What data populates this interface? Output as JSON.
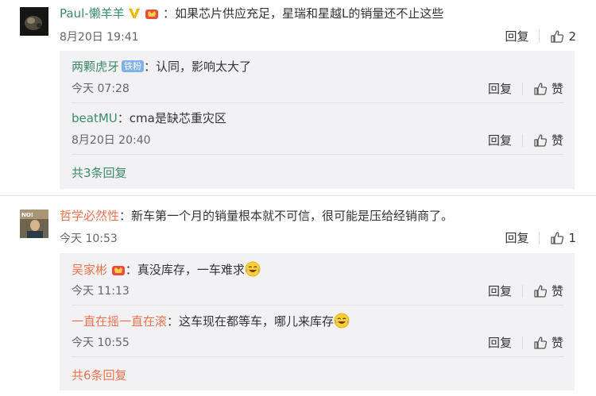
{
  "comments": [
    {
      "username": "Paul-懒羊羊",
      "text": "如果芯片供应充足，星瑞和星越L的销量还不止这些",
      "time": "8月20日 19:41",
      "reply_label": "回复",
      "like_count": "2",
      "replies": [
        {
          "username": "两颗虎牙",
          "badge": "铁粉",
          "text": "认同，影响太大了",
          "time": "今天 07:28",
          "reply_label": "回复",
          "like_label": "赞"
        },
        {
          "username": "beatMU",
          "text": "cma是缺芯重灾区",
          "time": "8月20日 20:40",
          "reply_label": "回复",
          "like_label": "赞"
        }
      ],
      "more_replies": "共3条回复"
    },
    {
      "username": "哲学必然性",
      "text": "新车第一个月的销量根本就不可信，很可能是压给经销商了。",
      "time": "今天 10:53",
      "reply_label": "回复",
      "like_count": "1",
      "avatar_text": "NO!",
      "replies": [
        {
          "username": "吴家彬",
          "text": "真没库存，一车难求",
          "time": "今天 11:13",
          "reply_label": "回复",
          "like_label": "赞"
        },
        {
          "username": "一直在摇一直在滚",
          "text": "这车现在都等车，哪儿来库存",
          "time": "今天 10:55",
          "reply_label": "回复",
          "like_label": "赞"
        }
      ],
      "more_replies": "共6条回复"
    }
  ],
  "colors": {
    "orange_name": "#eb7350",
    "green_name": "#3c8a6a",
    "reply_bg": "#f2f2f5"
  },
  "icons": [
    "vip-v-icon",
    "fan-crown-icon",
    "thumb-up-icon",
    "laughing-cry-emoji-icon"
  ]
}
